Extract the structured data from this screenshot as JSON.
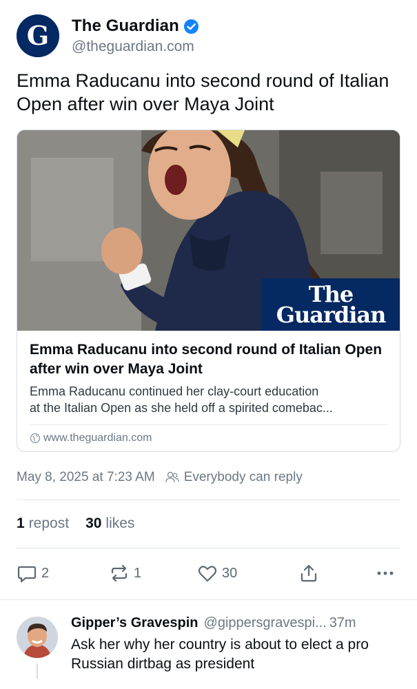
{
  "author": {
    "name": "The Guardian",
    "handle": "@theguardian.com",
    "verified": true,
    "avatar_letter": "G"
  },
  "post": {
    "text": "Emma Raducanu into second round of Italian Open after win over Maya Joint"
  },
  "card": {
    "brand_line1": "The",
    "brand_line2": "Guardian",
    "title": "Emma Raducanu into second round of Italian Open after win over Maya Joint",
    "description_line1": "Emma Raducanu continued her clay-court education",
    "description_line2": "at the Italian Open as she held off a spirited comebac...",
    "domain": "www.theguardian.com"
  },
  "meta": {
    "timestamp": "May 8, 2025 at 7:23 AM",
    "reply_setting": "Everybody can reply"
  },
  "stats": {
    "reposts_count": "1",
    "reposts_label": "repost",
    "likes_count": "30",
    "likes_label": "likes"
  },
  "actions": {
    "reply_count": "2",
    "repost_count": "1",
    "like_count": "30"
  },
  "reply": {
    "name": "Gipper’s Gravespin",
    "handle": "@gippersgravespi...",
    "time": "37m",
    "text": "Ask her why her country is about to elect a pro Russian dirtbag as president"
  },
  "colors": {
    "guardian_blue": "#052962",
    "verified_blue": "#1083fe",
    "muted_text": "#6b7785"
  }
}
